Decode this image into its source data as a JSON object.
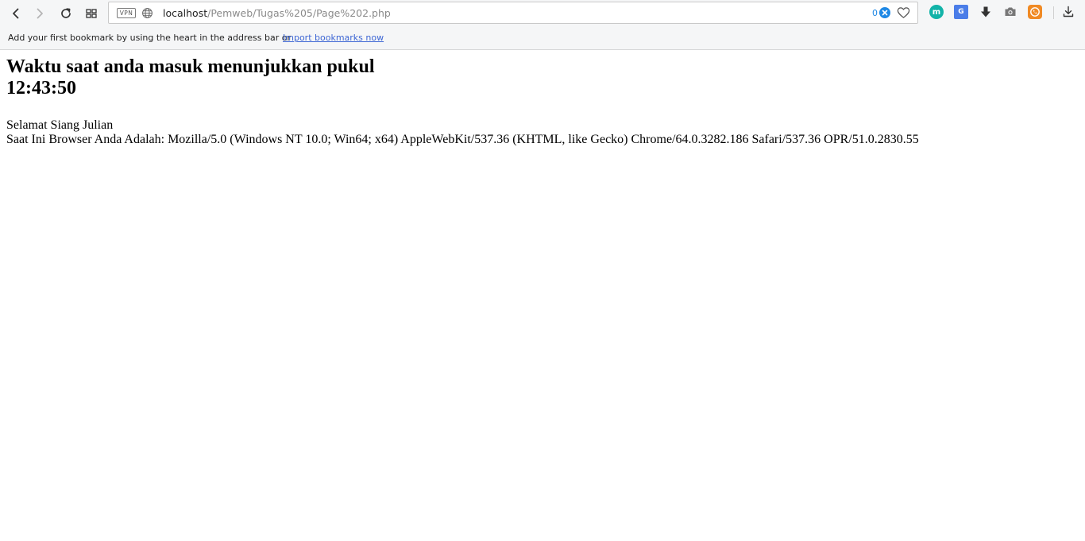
{
  "browser": {
    "vpn_label": "VPN",
    "url_host": "localhost",
    "url_path": "/Pemweb/Tugas%205/Page%202.php",
    "adblock_count": "0",
    "bookmarks_bar": {
      "message": "Add your first bookmark by using the heart in the address bar or",
      "import_link": "Import bookmarks now"
    },
    "extensions": {
      "m_label": "m",
      "translate_label": "G"
    }
  },
  "page": {
    "heading_line1": "Waktu saat anda masuk menunjukkan pukul",
    "heading_time": "12:43:50",
    "greeting": "Selamat Siang Julian",
    "user_agent_line": "Saat Ini Browser Anda Adalah: Mozilla/5.0 (Windows NT 10.0; Win64; x64) AppleWebKit/537.36 (KHTML, like Gecko) Chrome/64.0.3282.186 Safari/537.36 OPR/51.0.2830.55"
  }
}
